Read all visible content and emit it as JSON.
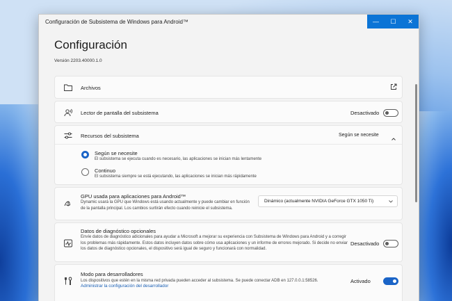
{
  "window": {
    "title": "Configuración de Subsistema de Windows para Android™",
    "minimize": "—",
    "maximize": "☐",
    "close": "✕"
  },
  "page": {
    "heading": "Configuración",
    "version": "Versión 2203.40000.1.0"
  },
  "files": {
    "title": "Archivos"
  },
  "screen_reader": {
    "title": "Lector de pantalla del subsistema",
    "status": "Desactivado",
    "enabled": false
  },
  "resources": {
    "title": "Recursos del subsistema",
    "selected": "Según se necesite",
    "options": [
      {
        "label": "Según se necesite",
        "desc": "El subsistema se ejecuta cuando es necesario, las aplicaciones se inician más lentamente",
        "checked": true
      },
      {
        "label": "Continuo",
        "desc": "El subsistema siempre se está ejecutando, las aplicaciones se inician más rápidamente",
        "checked": false
      }
    ]
  },
  "gpu": {
    "title": "GPU usada para aplicaciones para Android™",
    "desc": "Dynamic usará la GPU que Windows está usando actualmente y puede cambiar en función de la pantalla principal. Los cambios surtirán efecto cuando reinicie el subsistema.",
    "selected": "Dinámico (actualmente NVIDIA GeForce GTX 1050 Ti)"
  },
  "diagnostics": {
    "title": "Datos de diagnóstico opcionales",
    "desc": "Envíe datos de diagnóstico adicionales para ayudar a Microsoft a mejorar su experiencia con Subsistema de Windows para Android y a corregir los problemas más rápidamente. Estos datos incluyen datos sobre cómo usa aplicaciones y un informe de errores mejorado. Si decide no enviar los datos de diagnóstico opcionales, el dispositivo será igual de seguro y funcionará con normalidad.",
    "status": "Desactivado",
    "enabled": false
  },
  "developer": {
    "title": "Modo para desarrolladores",
    "desc": "Los dispositivos que estén en la misma red privada pueden acceder al subsistema. Se puede conectar ADB en 127.0.0.1:58526.",
    "link": "Administrar la configuración del desarrollador",
    "status": "Activado",
    "enabled": true
  },
  "colors": {
    "accent": "#1a64c7",
    "caption": "#0b74d6",
    "link": "#1a5fb4"
  }
}
